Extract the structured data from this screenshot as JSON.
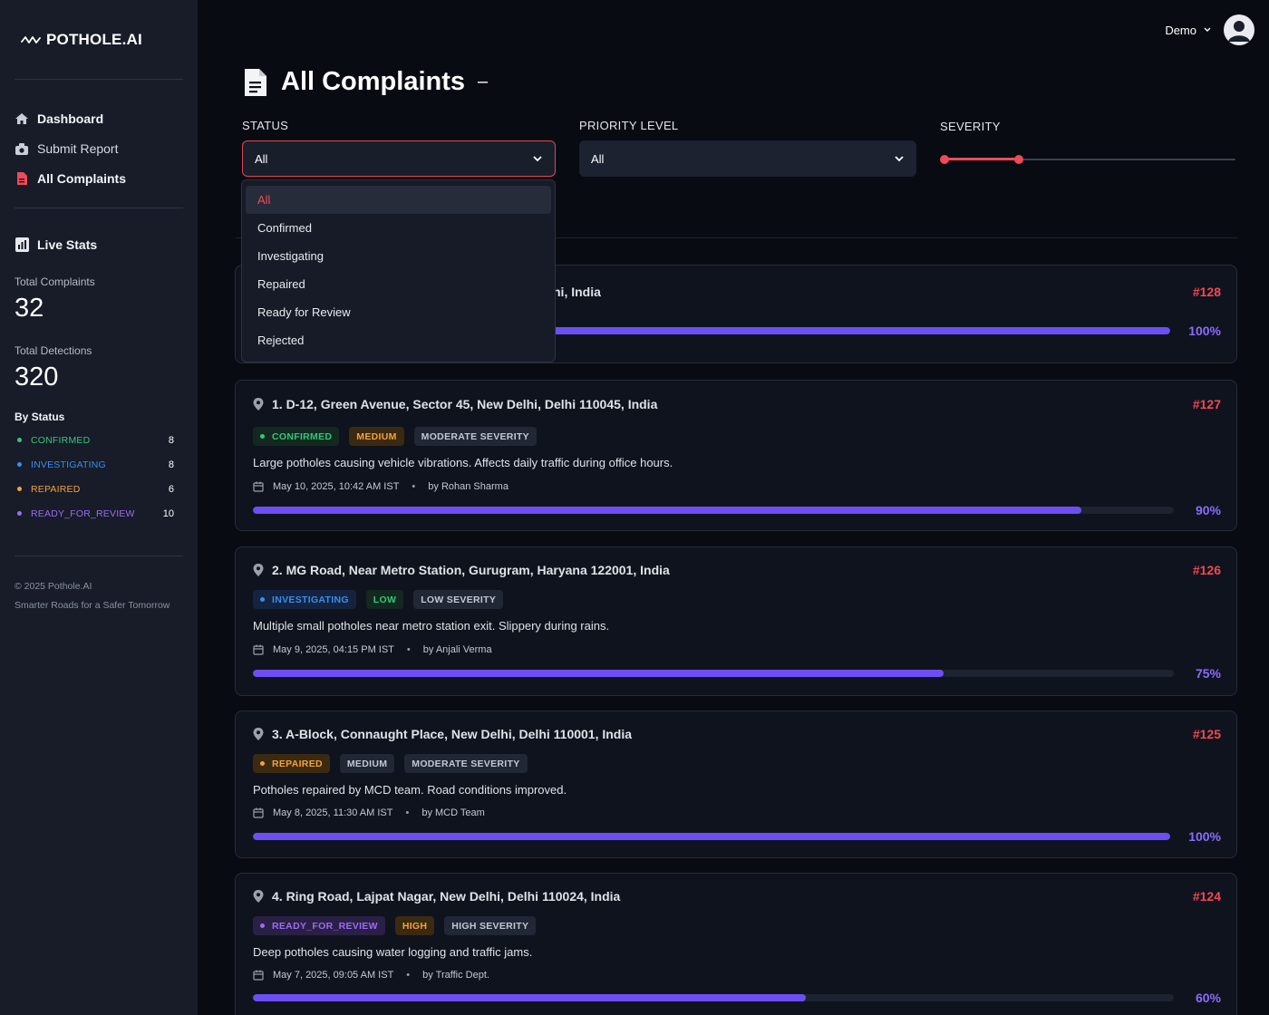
{
  "app": {
    "logo_text": "POTHOLE.AI"
  },
  "sidebar": {
    "nav": [
      {
        "label": "Dashboard",
        "icon": "home-icon"
      },
      {
        "label": "Submit Report",
        "icon": "camera-icon"
      },
      {
        "label": "All Complaints",
        "icon": "file-icon"
      }
    ],
    "live_stats": {
      "title": "Live Stats",
      "total_complaints_label": "Total Complaints",
      "total_complaints": "32",
      "total_detections_label": "Total Detections",
      "total_detections": "320",
      "by_status_label": "By Status",
      "status": [
        {
          "name": "CONFIRMED",
          "count": "8",
          "color": "#34c77b"
        },
        {
          "name": "INVESTIGATING",
          "count": "8",
          "color": "#3b8cf0"
        },
        {
          "name": "REPAIRED",
          "count": "6",
          "color": "#f5a235"
        },
        {
          "name": "READY_FOR_REVIEW",
          "count": "10",
          "color": "#9b6cf5"
        }
      ]
    },
    "footer": {
      "copyright": "© 2025 Pothole.AI",
      "tagline": "Smarter Roads for a Safer Tomorrow"
    }
  },
  "topbar": {
    "user_name": "Demo"
  },
  "page": {
    "title": "All Complaints",
    "title_suffix": "–"
  },
  "filters": {
    "status_label": "STATUS",
    "status_value": "All",
    "priority_label": "PRIORITY LEVEL",
    "priority_value": "All",
    "severity_label": "SEVERITY",
    "severity_range": [
      0,
      0.26
    ],
    "status_options": [
      "All",
      "Confirmed",
      "Investigating",
      "Repaired",
      "Ready for Review",
      "Rejected"
    ]
  },
  "complaints": [
    {
      "location": "hi, India",
      "id": "#128",
      "progress": 100,
      "progress_label": "100%"
    },
    {
      "location": "1. D-12, Green Avenue, Sector 45, New Delhi, Delhi 110045, India",
      "id": "#127",
      "status": "CONFIRMED",
      "priority": "MEDIUM",
      "severity": "MODERATE SEVERITY",
      "description": "Large potholes causing vehicle vibrations. Affects daily traffic during office hours.",
      "date": "May 10, 2025, 10:42 AM IST",
      "author": "by Rohan Sharma",
      "progress": 90,
      "progress_label": "90%"
    },
    {
      "location": "2. MG Road, Near Metro Station, Gurugram, Haryana 122001, India",
      "id": "#126",
      "status": "INVESTIGATING",
      "priority": "LOW",
      "severity": "LOW SEVERITY",
      "description": "Multiple small potholes near metro station exit. Slippery during rains.",
      "date": "May 9, 2025, 04:15 PM IST",
      "author": "by Anjali Verma",
      "progress": 75,
      "progress_label": "75%"
    },
    {
      "location": "3. A-Block, Connaught Place, New Delhi, Delhi 110001, India",
      "id": "#125",
      "status": "REPAIRED",
      "priority": "MEDIUM",
      "severity": "MODERATE SEVERITY",
      "description": "Potholes repaired by MCD team. Road conditions improved.",
      "date": "May 8, 2025, 11:30 AM IST",
      "author": "by MCD Team",
      "progress": 100,
      "progress_label": "100%"
    },
    {
      "location": "4. Ring Road, Lajpat Nagar, New Delhi, Delhi 110024, India",
      "id": "#124",
      "status": "READY_FOR_REVIEW",
      "priority": "HIGH",
      "severity": "HIGH SEVERITY",
      "description": "Deep potholes causing water logging and traffic jams.",
      "date": "May 7, 2025, 09:05 AM IST",
      "author": "by Traffic Dept.",
      "progress": 60,
      "progress_label": "60%"
    }
  ]
}
